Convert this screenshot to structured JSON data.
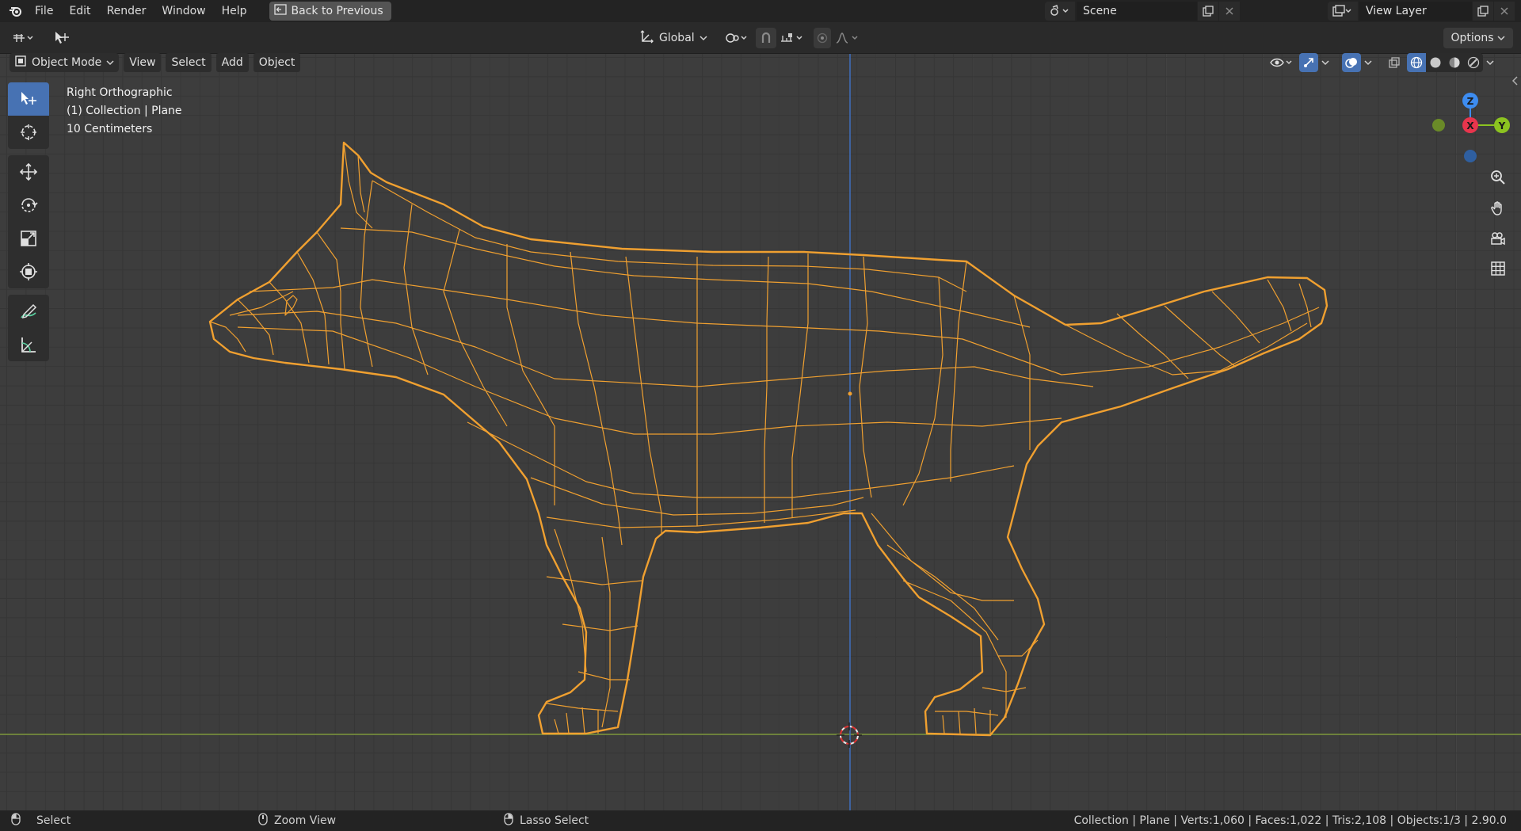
{
  "menubar": {
    "items": [
      "File",
      "Edit",
      "Render",
      "Window",
      "Help"
    ],
    "back_button": "Back to Previous",
    "scene_name": "Scene",
    "view_layer_name": "View Layer"
  },
  "toolbar": {
    "orientation": "Global",
    "options_label": "Options"
  },
  "viewport_header": {
    "mode": "Object Mode",
    "menus": [
      "View",
      "Select",
      "Add",
      "Object"
    ]
  },
  "viewport_overlay": {
    "view_name": "Right Orthographic",
    "collection_info": "(1) Collection | Plane",
    "scale": "10 Centimeters"
  },
  "gizmo": {
    "axis_z": "Z",
    "axis_x": "X",
    "axis_y": "Y"
  },
  "statusbar": {
    "left_click": "Select",
    "middle_click": "Zoom View",
    "right_click": "Lasso Select",
    "stats": "Collection | Plane | Verts:1,060 | Faces:1,022 | Tris:2,108 | Objects:1/3 | 2.90.0"
  },
  "colors": {
    "accent_blue": "#4772b3",
    "wire_orange": "#f0a030",
    "axis_x": "#e8354d",
    "axis_y": "#8cc320",
    "axis_z": "#3d8cf0",
    "y_axis_line": "#7f9a3d",
    "z_axis_line": "#3f6fbd"
  }
}
